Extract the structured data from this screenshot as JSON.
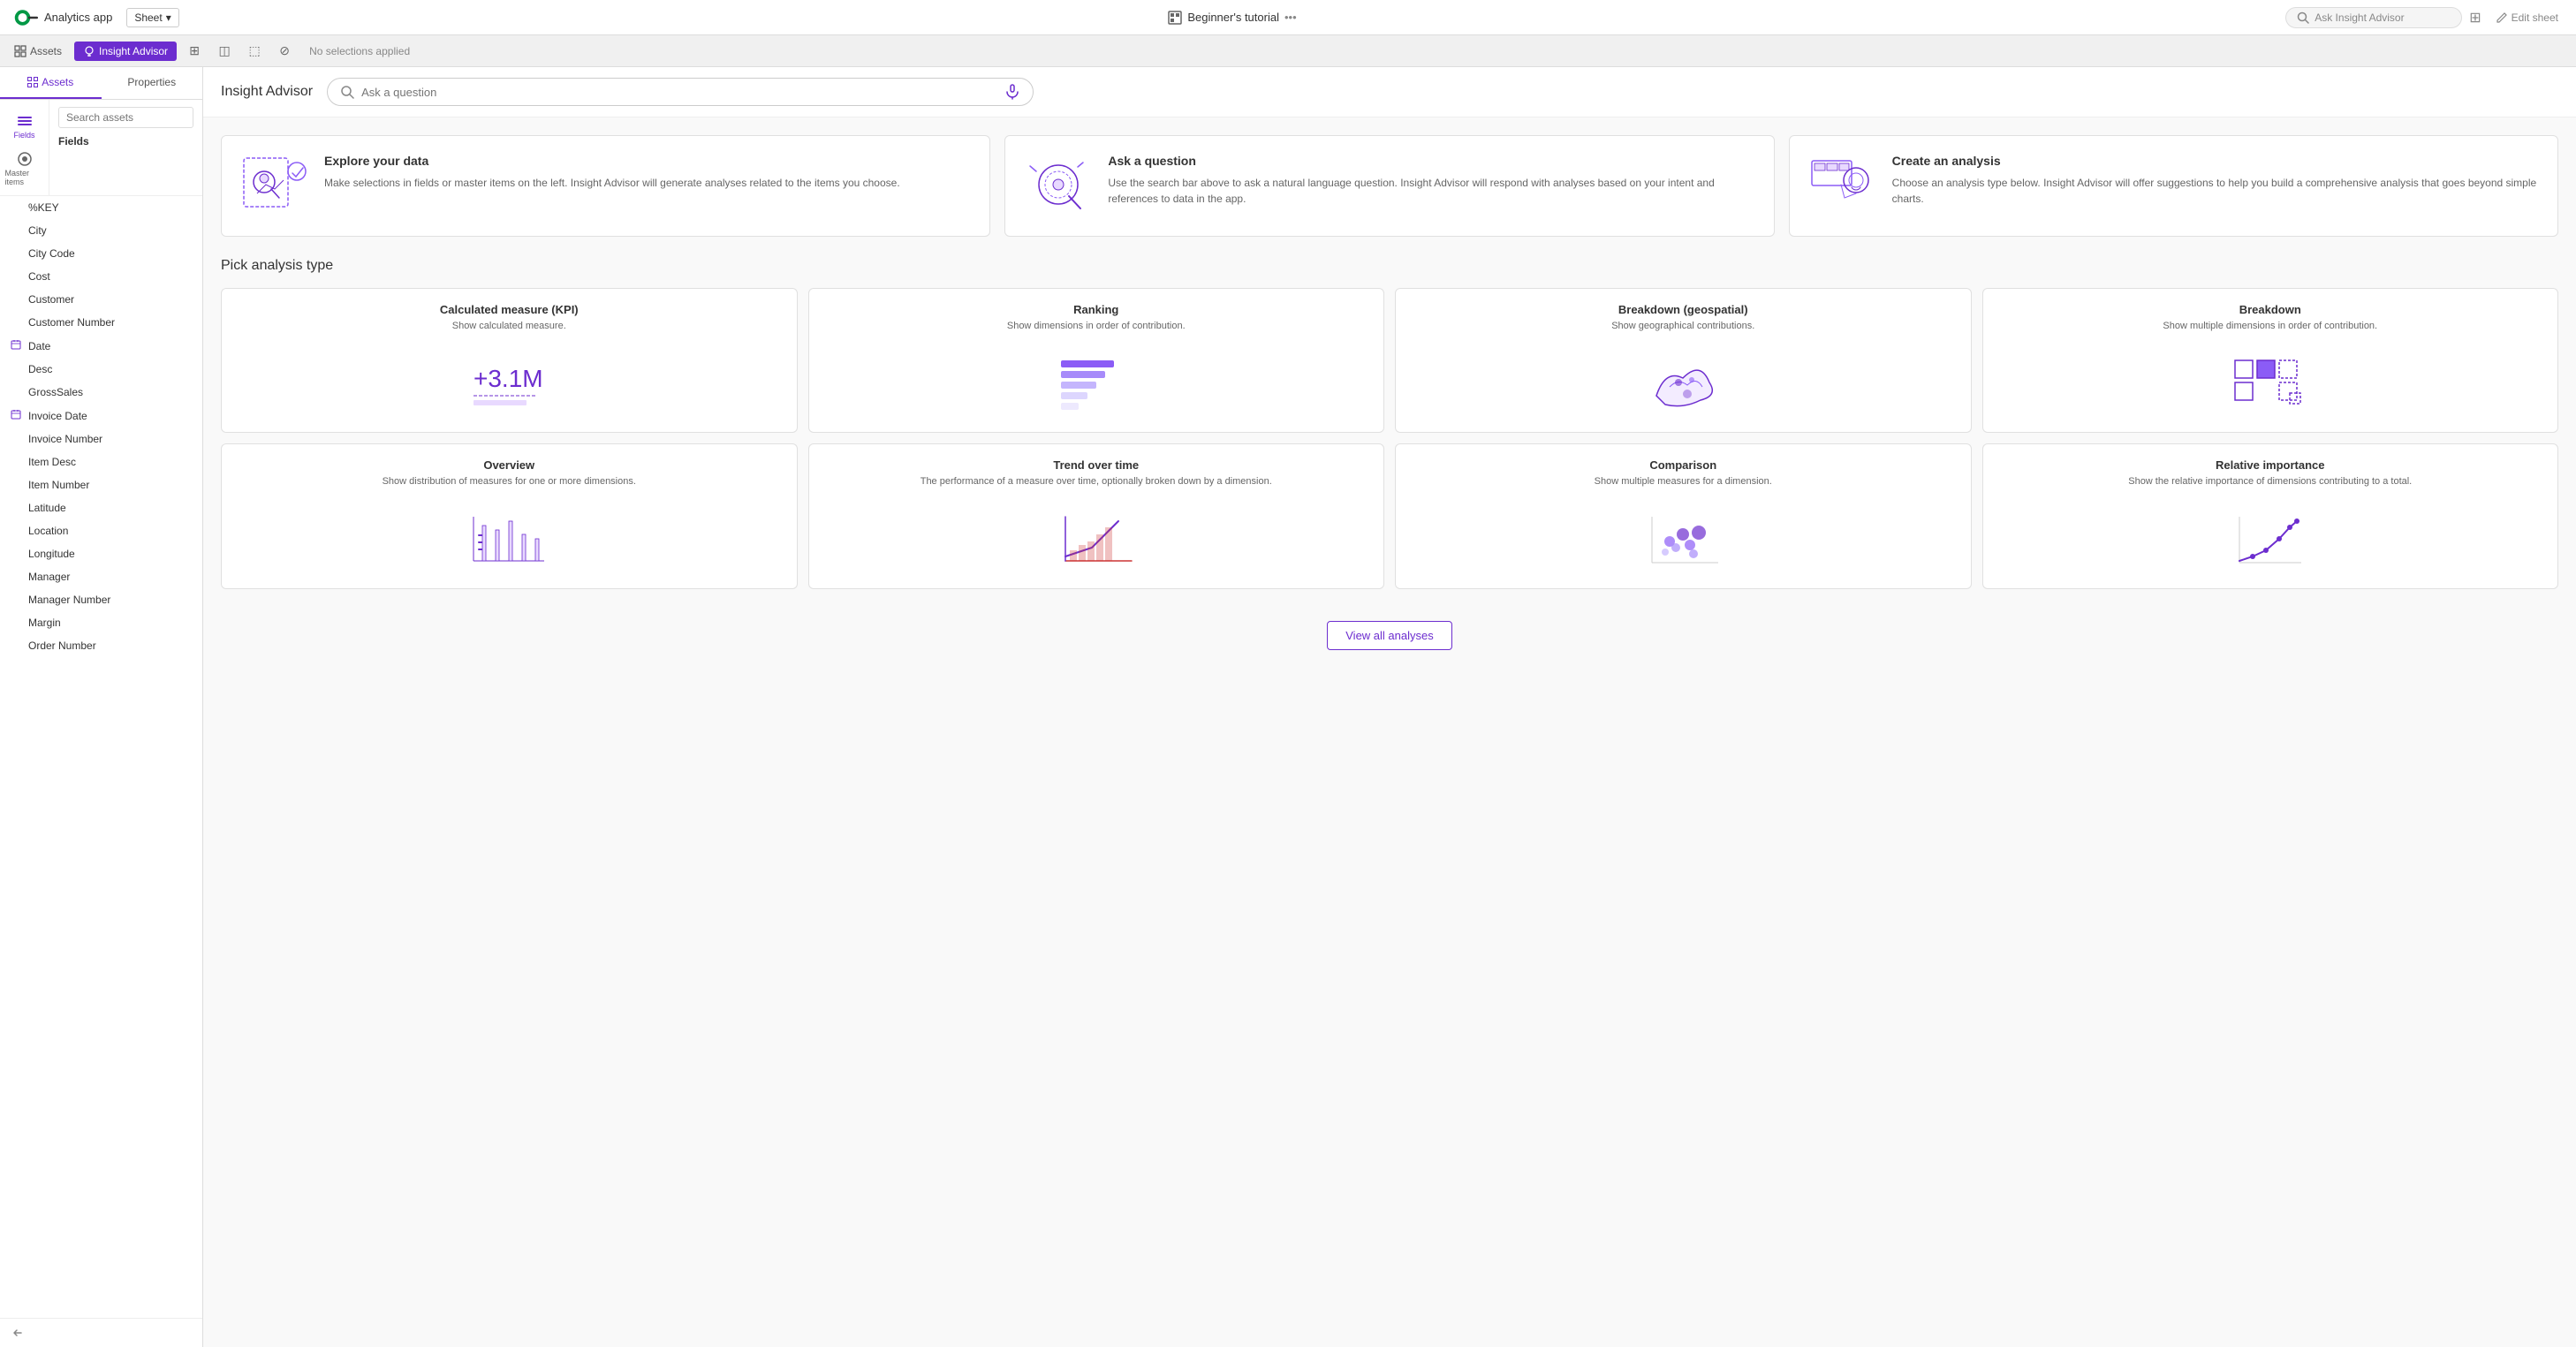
{
  "topNav": {
    "logoAlt": "Qlik",
    "appName": "Analytics app",
    "sheetDropdown": "Sheet",
    "appTitle": "Beginner's tutorial",
    "moreOptions": "...",
    "searchPlaceholder": "Ask Insight Advisor",
    "editSheet": "Edit sheet"
  },
  "toolbar": {
    "assetsBtn": "Assets",
    "insightBtn": "Insight Advisor",
    "noSelections": "No selections applied"
  },
  "sidebar": {
    "assetsTab": "Assets",
    "propertiesTab": "Properties",
    "searchPlaceholder": "Search assets",
    "fieldsHeader": "Fields",
    "miniIcons": [
      {
        "name": "fields",
        "label": "Fields"
      },
      {
        "name": "master-items",
        "label": "Master items"
      }
    ],
    "fields": [
      {
        "name": "%KEY",
        "type": "text",
        "hasCalendar": false
      },
      {
        "name": "City",
        "type": "text",
        "hasCalendar": false
      },
      {
        "name": "City Code",
        "type": "text",
        "hasCalendar": false
      },
      {
        "name": "Cost",
        "type": "text",
        "hasCalendar": false
      },
      {
        "name": "Customer",
        "type": "text",
        "hasCalendar": false
      },
      {
        "name": "Customer Number",
        "type": "text",
        "hasCalendar": false
      },
      {
        "name": "Date",
        "type": "calendar",
        "hasCalendar": true
      },
      {
        "name": "Desc",
        "type": "text",
        "hasCalendar": false
      },
      {
        "name": "GrossSales",
        "type": "text",
        "hasCalendar": false
      },
      {
        "name": "Invoice Date",
        "type": "calendar",
        "hasCalendar": true
      },
      {
        "name": "Invoice Number",
        "type": "text",
        "hasCalendar": false
      },
      {
        "name": "Item Desc",
        "type": "text",
        "hasCalendar": false
      },
      {
        "name": "Item Number",
        "type": "text",
        "hasCalendar": false
      },
      {
        "name": "Latitude",
        "type": "text",
        "hasCalendar": false
      },
      {
        "name": "Location",
        "type": "text",
        "hasCalendar": false
      },
      {
        "name": "Longitude",
        "type": "text",
        "hasCalendar": false
      },
      {
        "name": "Manager",
        "type": "text",
        "hasCalendar": false
      },
      {
        "name": "Manager Number",
        "type": "text",
        "hasCalendar": false
      },
      {
        "name": "Margin",
        "type": "text",
        "hasCalendar": false
      },
      {
        "name": "Order Number",
        "type": "text",
        "hasCalendar": false
      }
    ]
  },
  "insightAdvisor": {
    "title": "Insight Advisor",
    "askPlaceholder": "Ask a question"
  },
  "introCards": [
    {
      "key": "explore",
      "title": "Explore your data",
      "description": "Make selections in fields or master items on the left. Insight Advisor will generate analyses related to the items you choose."
    },
    {
      "key": "ask",
      "title": "Ask a question",
      "description": "Use the search bar above to ask a natural language question. Insight Advisor will respond with analyses based on your intent and references to data in the app."
    },
    {
      "key": "create",
      "title": "Create an analysis",
      "description": "Choose an analysis type below. Insight Advisor will offer suggestions to help you build a comprehensive analysis that goes beyond simple charts."
    }
  ],
  "analysisSection": {
    "sectionTitle": "Pick analysis type",
    "viewAllBtn": "View all analyses",
    "analysisTypes": [
      {
        "key": "kpi",
        "title": "Calculated measure (KPI)",
        "description": "Show calculated measure.",
        "visual": "kpi"
      },
      {
        "key": "ranking",
        "title": "Ranking",
        "description": "Show dimensions in order of contribution.",
        "visual": "ranking"
      },
      {
        "key": "breakdown-geo",
        "title": "Breakdown (geospatial)",
        "description": "Show geographical contributions.",
        "visual": "geo"
      },
      {
        "key": "breakdown",
        "title": "Breakdown",
        "description": "Show multiple dimensions in order of contribution.",
        "visual": "breakdown"
      },
      {
        "key": "overview",
        "title": "Overview",
        "description": "Show distribution of measures for one or more dimensions.",
        "visual": "overview"
      },
      {
        "key": "trend",
        "title": "Trend over time",
        "description": "The performance of a measure over time, optionally broken down by a dimension.",
        "visual": "trend"
      },
      {
        "key": "comparison",
        "title": "Comparison",
        "description": "Show multiple measures for a dimension.",
        "visual": "comparison"
      },
      {
        "key": "relative",
        "title": "Relative importance",
        "description": "Show the relative importance of dimensions contributing to a total.",
        "visual": "relative"
      }
    ]
  },
  "colors": {
    "purple": "#6c2dcf",
    "lightPurple": "#9b6de0",
    "veryLightPurple": "#e8d9ff",
    "accent": "#6c2dcf"
  }
}
